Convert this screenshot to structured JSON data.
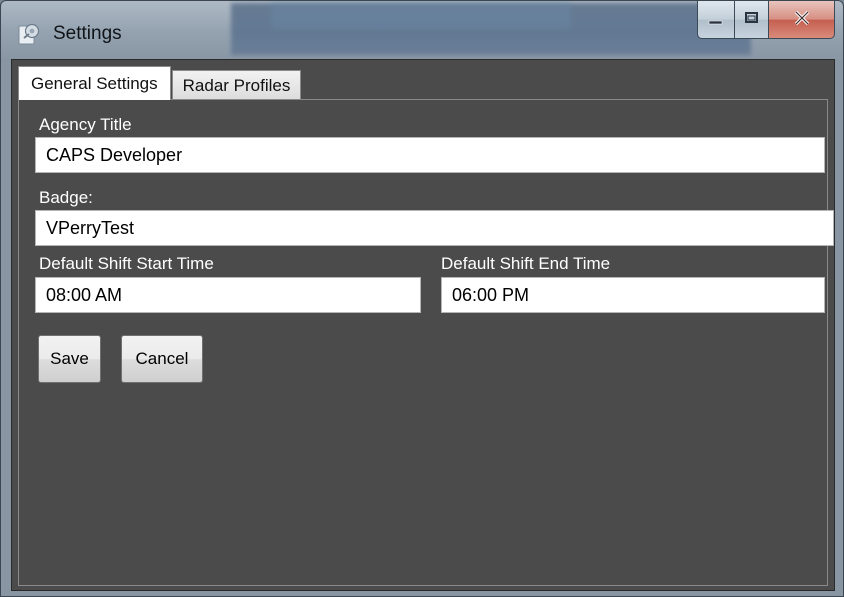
{
  "window": {
    "title": "Settings",
    "app_icon": "settings-app-icon",
    "caption_icons": [
      "minimize-icon",
      "maximize-icon",
      "close-icon"
    ]
  },
  "tabs": [
    {
      "label": "General Settings",
      "active": true
    },
    {
      "label": "Radar Profiles",
      "active": false
    }
  ],
  "form": {
    "agency_title_label": "Agency Title",
    "agency_title_value": "CAPS Developer",
    "badge_label": "Badge:",
    "badge_value": "VPerryTest",
    "shift_start_label": "Default Shift Start Time",
    "shift_start_value": "08:00 AM",
    "shift_end_label": "Default Shift End Time",
    "shift_end_value": "06:00 PM"
  },
  "buttons": {
    "save_label": "Save",
    "cancel_label": "Cancel"
  },
  "colors": {
    "panel_background": "#4b4b4b",
    "label_text": "#ffffff",
    "field_background": "#ffffff"
  }
}
